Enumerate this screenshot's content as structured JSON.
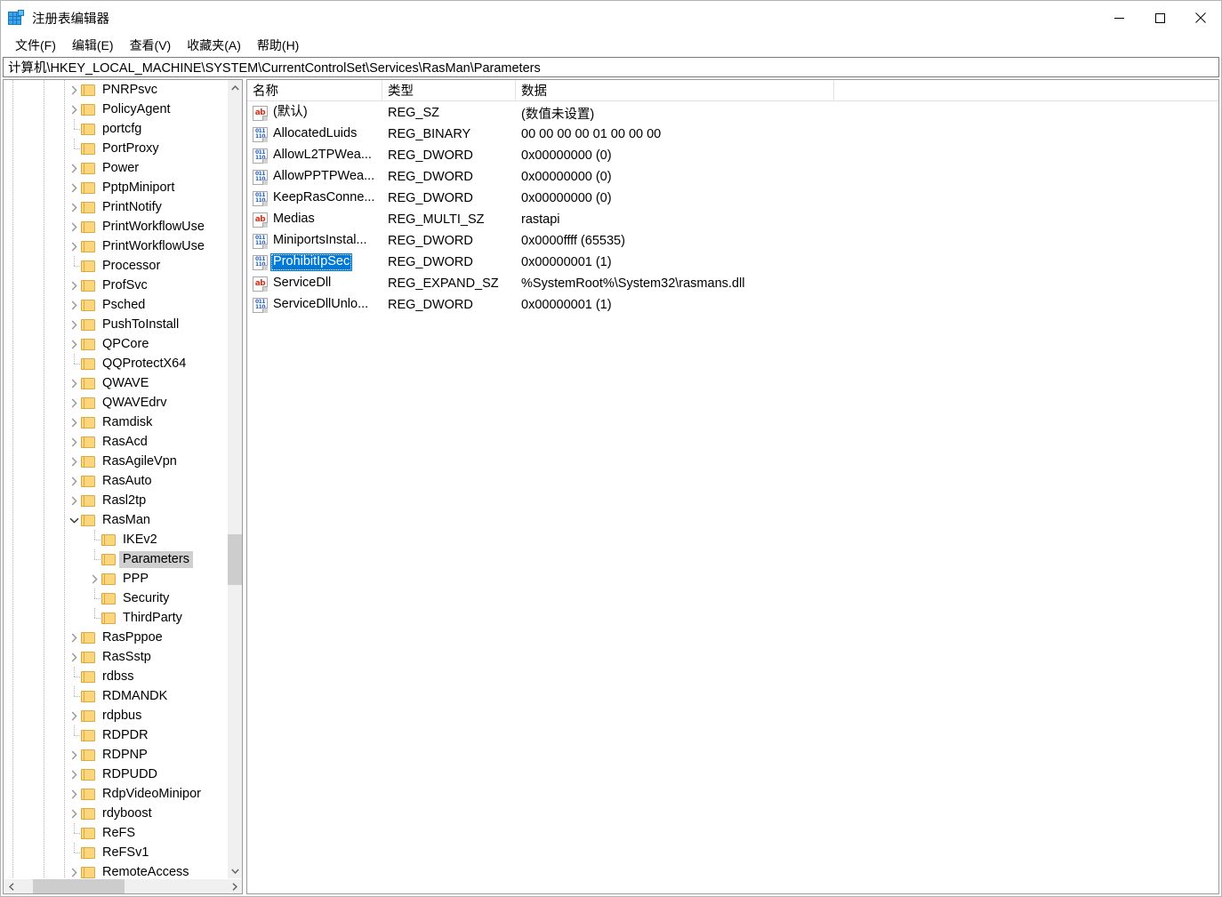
{
  "window": {
    "title": "注册表编辑器",
    "icon": "registry-editor-icon",
    "controls": {
      "minimize": "minimize-icon",
      "maximize": "maximize-icon",
      "close": "close-icon"
    }
  },
  "menu": {
    "items": [
      {
        "label": "文件(F)"
      },
      {
        "label": "编辑(E)"
      },
      {
        "label": "查看(V)"
      },
      {
        "label": "收藏夹(A)"
      },
      {
        "label": "帮助(H)"
      }
    ]
  },
  "address": {
    "path": "计算机\\HKEY_LOCAL_MACHINE\\SYSTEM\\CurrentControlSet\\Services\\RasMan\\Parameters"
  },
  "tree": {
    "items": [
      {
        "label": "PNRPsvc",
        "indent": 3,
        "expander": "collapsed",
        "selected": false
      },
      {
        "label": "PolicyAgent",
        "indent": 3,
        "expander": "collapsed",
        "selected": false
      },
      {
        "label": "portcfg",
        "indent": 3,
        "expander": "none",
        "selected": false
      },
      {
        "label": "PortProxy",
        "indent": 3,
        "expander": "none",
        "selected": false
      },
      {
        "label": "Power",
        "indent": 3,
        "expander": "collapsed",
        "selected": false
      },
      {
        "label": "PptpMiniport",
        "indent": 3,
        "expander": "collapsed",
        "selected": false
      },
      {
        "label": "PrintNotify",
        "indent": 3,
        "expander": "collapsed",
        "selected": false
      },
      {
        "label": "PrintWorkflowUse",
        "indent": 3,
        "expander": "collapsed",
        "selected": false
      },
      {
        "label": "PrintWorkflowUse",
        "indent": 3,
        "expander": "collapsed",
        "selected": false
      },
      {
        "label": "Processor",
        "indent": 3,
        "expander": "none",
        "selected": false
      },
      {
        "label": "ProfSvc",
        "indent": 3,
        "expander": "collapsed",
        "selected": false
      },
      {
        "label": "Psched",
        "indent": 3,
        "expander": "collapsed",
        "selected": false
      },
      {
        "label": "PushToInstall",
        "indent": 3,
        "expander": "collapsed",
        "selected": false
      },
      {
        "label": "QPCore",
        "indent": 3,
        "expander": "collapsed",
        "selected": false
      },
      {
        "label": "QQProtectX64",
        "indent": 3,
        "expander": "none",
        "selected": false
      },
      {
        "label": "QWAVE",
        "indent": 3,
        "expander": "collapsed",
        "selected": false
      },
      {
        "label": "QWAVEdrv",
        "indent": 3,
        "expander": "collapsed",
        "selected": false
      },
      {
        "label": "Ramdisk",
        "indent": 3,
        "expander": "collapsed",
        "selected": false
      },
      {
        "label": "RasAcd",
        "indent": 3,
        "expander": "collapsed",
        "selected": false
      },
      {
        "label": "RasAgileVpn",
        "indent": 3,
        "expander": "collapsed",
        "selected": false
      },
      {
        "label": "RasAuto",
        "indent": 3,
        "expander": "collapsed",
        "selected": false
      },
      {
        "label": "Rasl2tp",
        "indent": 3,
        "expander": "collapsed",
        "selected": false
      },
      {
        "label": "RasMan",
        "indent": 3,
        "expander": "expanded",
        "selected": false
      },
      {
        "label": "IKEv2",
        "indent": 4,
        "expander": "none",
        "selected": false
      },
      {
        "label": "Parameters",
        "indent": 4,
        "expander": "none",
        "selected": true
      },
      {
        "label": "PPP",
        "indent": 4,
        "expander": "collapsed",
        "selected": false
      },
      {
        "label": "Security",
        "indent": 4,
        "expander": "none",
        "selected": false
      },
      {
        "label": "ThirdParty",
        "indent": 4,
        "expander": "none",
        "selected": false
      },
      {
        "label": "RasPppoe",
        "indent": 3,
        "expander": "collapsed",
        "selected": false
      },
      {
        "label": "RasSstp",
        "indent": 3,
        "expander": "collapsed",
        "selected": false
      },
      {
        "label": "rdbss",
        "indent": 3,
        "expander": "none",
        "selected": false
      },
      {
        "label": "RDMANDK",
        "indent": 3,
        "expander": "none",
        "selected": false
      },
      {
        "label": "rdpbus",
        "indent": 3,
        "expander": "collapsed",
        "selected": false
      },
      {
        "label": "RDPDR",
        "indent": 3,
        "expander": "none",
        "selected": false
      },
      {
        "label": "RDPNP",
        "indent": 3,
        "expander": "collapsed",
        "selected": false
      },
      {
        "label": "RDPUDD",
        "indent": 3,
        "expander": "collapsed",
        "selected": false
      },
      {
        "label": "RdpVideoMinipor",
        "indent": 3,
        "expander": "collapsed",
        "selected": false
      },
      {
        "label": "rdyboost",
        "indent": 3,
        "expander": "collapsed",
        "selected": false
      },
      {
        "label": "ReFS",
        "indent": 3,
        "expander": "none",
        "selected": false
      },
      {
        "label": "ReFSv1",
        "indent": 3,
        "expander": "none",
        "selected": false
      },
      {
        "label": "RemoteAccess",
        "indent": 3,
        "expander": "collapsed",
        "selected": false
      }
    ]
  },
  "list": {
    "columns": [
      {
        "label": "名称"
      },
      {
        "label": "类型"
      },
      {
        "label": "数据"
      }
    ],
    "rows": [
      {
        "name": "(默认)",
        "icon": "string-value-icon",
        "type": "REG_SZ",
        "data": "(数值未设置)",
        "selected": false
      },
      {
        "name": "AllocatedLuids",
        "icon": "binary-value-icon",
        "type": "REG_BINARY",
        "data": "00 00 00 00 01 00 00 00",
        "selected": false
      },
      {
        "name": "AllowL2TPWea...",
        "icon": "binary-value-icon",
        "type": "REG_DWORD",
        "data": "0x00000000 (0)",
        "selected": false
      },
      {
        "name": "AllowPPTPWea...",
        "icon": "binary-value-icon",
        "type": "REG_DWORD",
        "data": "0x00000000 (0)",
        "selected": false
      },
      {
        "name": "KeepRasConne...",
        "icon": "binary-value-icon",
        "type": "REG_DWORD",
        "data": "0x00000000 (0)",
        "selected": false
      },
      {
        "name": "Medias",
        "icon": "string-value-icon",
        "type": "REG_MULTI_SZ",
        "data": "rastapi",
        "selected": false
      },
      {
        "name": "MiniportsInstal...",
        "icon": "binary-value-icon",
        "type": "REG_DWORD",
        "data": "0x0000ffff (65535)",
        "selected": false
      },
      {
        "name": "ProhibitIpSec",
        "icon": "binary-value-icon",
        "type": "REG_DWORD",
        "data": "0x00000001 (1)",
        "selected": true
      },
      {
        "name": "ServiceDll",
        "icon": "string-value-icon",
        "type": "REG_EXPAND_SZ",
        "data": "%SystemRoot%\\System32\\rasmans.dll",
        "selected": false
      },
      {
        "name": "ServiceDllUnlo...",
        "icon": "binary-value-icon",
        "type": "REG_DWORD",
        "data": "0x00000001 (1)",
        "selected": false
      }
    ]
  },
  "colors": {
    "selection": "#0078d7",
    "tree_selection": "#cfcfcf",
    "folder": "#fcd67c",
    "string_icon": "#d3321b",
    "binary_icon": "#1f5fbf"
  }
}
